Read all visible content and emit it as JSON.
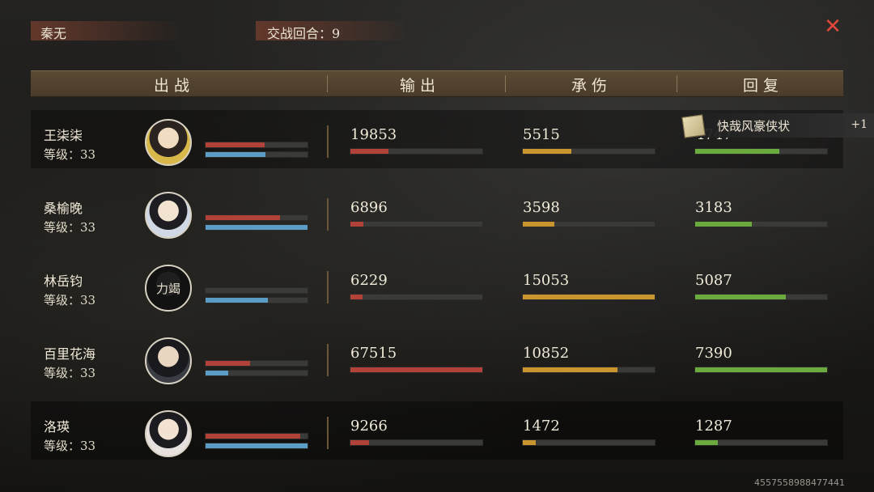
{
  "player_name": "秦无",
  "round_label": "交战回合：9",
  "close_icon": "close-x-icon",
  "headers": {
    "deploy": "出战",
    "output": "输出",
    "damage_taken": "承伤",
    "recovery": "回复"
  },
  "award": {
    "icon": "scroll-icon",
    "text": "快哉风豪侠状",
    "count": "+1"
  },
  "colors": {
    "hp_bar": "#b0423a",
    "mp_bar": "#5b9dc4",
    "output_bar": "#b0423a",
    "damage_bar": "#c8952f",
    "recovery_bar": "#6aaa3e",
    "close": "#e2473b"
  },
  "characters": [
    {
      "name": "王柒柒",
      "level": "等级：33",
      "avatar": "female-warrior-yellow-avatar",
      "hp_fraction": 0.58,
      "mp_fraction": 0.59,
      "output": "19853",
      "output_fraction": 0.29,
      "damage": "5515",
      "damage_fraction": 0.37,
      "recovery": "4747",
      "recovery_fraction": 0.64
    },
    {
      "name": "桑榆晚",
      "level": "等级：33",
      "avatar": "female-scholar-avatar",
      "hp_fraction": 0.73,
      "mp_fraction": 1.0,
      "output": "6896",
      "output_fraction": 0.1,
      "damage": "3598",
      "damage_fraction": 0.24,
      "recovery": "3183",
      "recovery_fraction": 0.43
    },
    {
      "name": "林岳钧",
      "level": "等级：33",
      "avatar": "exhausted-male-avatar",
      "avatar_overlay": "力竭",
      "hp_fraction": 0.0,
      "mp_fraction": 0.61,
      "output": "6229",
      "output_fraction": 0.09,
      "damage": "15053",
      "damage_fraction": 1.0,
      "recovery": "5087",
      "recovery_fraction": 0.69
    },
    {
      "name": "百里花海",
      "level": "等级：33",
      "avatar": "male-swordsman-avatar",
      "hp_fraction": 0.44,
      "mp_fraction": 0.22,
      "output": "67515",
      "output_fraction": 1.0,
      "damage": "10852",
      "damage_fraction": 0.72,
      "recovery": "7390",
      "recovery_fraction": 1.0
    },
    {
      "name": "洛瑛",
      "level": "等级：33",
      "avatar": "female-white-dress-avatar",
      "hp_fraction": 0.93,
      "mp_fraction": 1.0,
      "output": "9266",
      "output_fraction": 0.14,
      "damage": "1472",
      "damage_fraction": 0.1,
      "recovery": "1287",
      "recovery_fraction": 0.17
    }
  ],
  "uid": "4557558988477441"
}
